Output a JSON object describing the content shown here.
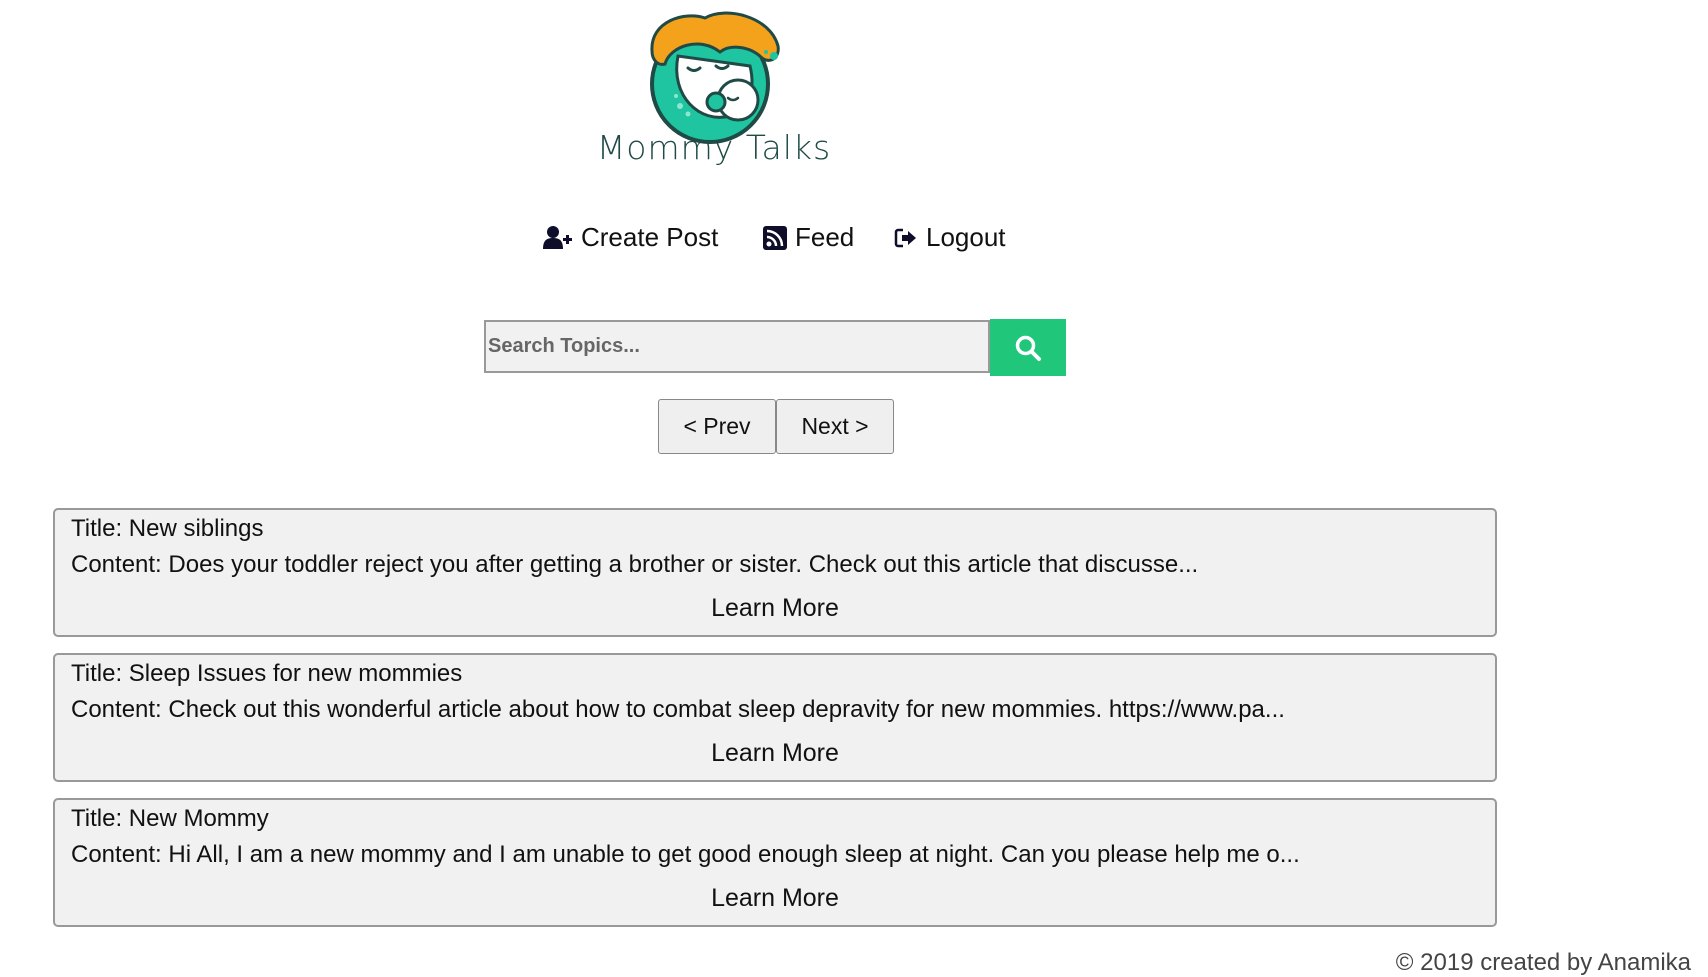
{
  "brand": {
    "name": "Mommy Talks"
  },
  "nav": {
    "items": [
      {
        "label": "Create Post",
        "icon": "user-plus-icon"
      },
      {
        "label": "Feed",
        "icon": "rss-icon"
      },
      {
        "label": "Logout",
        "icon": "sign-out-icon"
      }
    ]
  },
  "search": {
    "placeholder": "Search Topics...",
    "value": "",
    "button_icon": "search-icon",
    "button_color": "#20c77a"
  },
  "pager": {
    "prev_label": "< Prev",
    "next_label": "Next >"
  },
  "posts": [
    {
      "title": "Title: New siblings",
      "content": "Content: Does your toddler reject you after getting a brother or sister. Check out this article that discusse...",
      "link": "Learn More"
    },
    {
      "title": "Title: Sleep Issues for new mommies",
      "content": "Content: Check out this wonderful article about how to combat sleep depravity for new mommies. https://www.pa...",
      "link": "Learn More"
    },
    {
      "title": "Title: New Mommy",
      "content": "Content: Hi All, I am a new mommy and I am unable to get good enough sleep at night. Can you please help me o...",
      "link": "Learn More"
    }
  ],
  "footer": {
    "text": "© 2019 created by Anamika"
  },
  "colors": {
    "accent": "#20c77a",
    "logo_orange": "#f4a21c",
    "logo_teal": "#1fc4a0",
    "logo_dark": "#1f4a46"
  }
}
